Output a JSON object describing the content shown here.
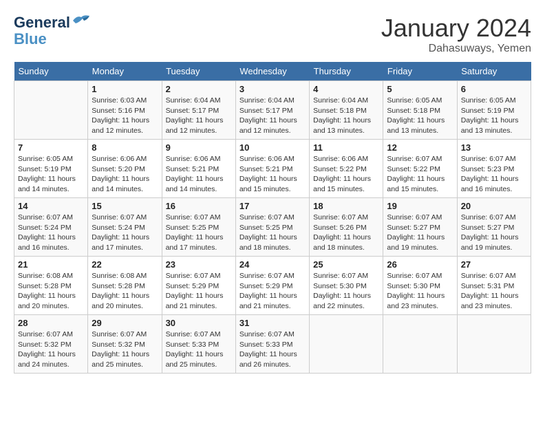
{
  "header": {
    "logo_line1": "General",
    "logo_line2": "Blue",
    "month_title": "January 2024",
    "location": "Dahasuways, Yemen"
  },
  "weekdays": [
    "Sunday",
    "Monday",
    "Tuesday",
    "Wednesday",
    "Thursday",
    "Friday",
    "Saturday"
  ],
  "weeks": [
    [
      {
        "day": "",
        "sunrise": "",
        "sunset": "",
        "daylight": ""
      },
      {
        "day": "1",
        "sunrise": "Sunrise: 6:03 AM",
        "sunset": "Sunset: 5:16 PM",
        "daylight": "Daylight: 11 hours and 12 minutes."
      },
      {
        "day": "2",
        "sunrise": "Sunrise: 6:04 AM",
        "sunset": "Sunset: 5:17 PM",
        "daylight": "Daylight: 11 hours and 12 minutes."
      },
      {
        "day": "3",
        "sunrise": "Sunrise: 6:04 AM",
        "sunset": "Sunset: 5:17 PM",
        "daylight": "Daylight: 11 hours and 12 minutes."
      },
      {
        "day": "4",
        "sunrise": "Sunrise: 6:04 AM",
        "sunset": "Sunset: 5:18 PM",
        "daylight": "Daylight: 11 hours and 13 minutes."
      },
      {
        "day": "5",
        "sunrise": "Sunrise: 6:05 AM",
        "sunset": "Sunset: 5:18 PM",
        "daylight": "Daylight: 11 hours and 13 minutes."
      },
      {
        "day": "6",
        "sunrise": "Sunrise: 6:05 AM",
        "sunset": "Sunset: 5:19 PM",
        "daylight": "Daylight: 11 hours and 13 minutes."
      }
    ],
    [
      {
        "day": "7",
        "sunrise": "Sunrise: 6:05 AM",
        "sunset": "Sunset: 5:19 PM",
        "daylight": "Daylight: 11 hours and 14 minutes."
      },
      {
        "day": "8",
        "sunrise": "Sunrise: 6:06 AM",
        "sunset": "Sunset: 5:20 PM",
        "daylight": "Daylight: 11 hours and 14 minutes."
      },
      {
        "day": "9",
        "sunrise": "Sunrise: 6:06 AM",
        "sunset": "Sunset: 5:21 PM",
        "daylight": "Daylight: 11 hours and 14 minutes."
      },
      {
        "day": "10",
        "sunrise": "Sunrise: 6:06 AM",
        "sunset": "Sunset: 5:21 PM",
        "daylight": "Daylight: 11 hours and 15 minutes."
      },
      {
        "day": "11",
        "sunrise": "Sunrise: 6:06 AM",
        "sunset": "Sunset: 5:22 PM",
        "daylight": "Daylight: 11 hours and 15 minutes."
      },
      {
        "day": "12",
        "sunrise": "Sunrise: 6:07 AM",
        "sunset": "Sunset: 5:22 PM",
        "daylight": "Daylight: 11 hours and 15 minutes."
      },
      {
        "day": "13",
        "sunrise": "Sunrise: 6:07 AM",
        "sunset": "Sunset: 5:23 PM",
        "daylight": "Daylight: 11 hours and 16 minutes."
      }
    ],
    [
      {
        "day": "14",
        "sunrise": "Sunrise: 6:07 AM",
        "sunset": "Sunset: 5:24 PM",
        "daylight": "Daylight: 11 hours and 16 minutes."
      },
      {
        "day": "15",
        "sunrise": "Sunrise: 6:07 AM",
        "sunset": "Sunset: 5:24 PM",
        "daylight": "Daylight: 11 hours and 17 minutes."
      },
      {
        "day": "16",
        "sunrise": "Sunrise: 6:07 AM",
        "sunset": "Sunset: 5:25 PM",
        "daylight": "Daylight: 11 hours and 17 minutes."
      },
      {
        "day": "17",
        "sunrise": "Sunrise: 6:07 AM",
        "sunset": "Sunset: 5:25 PM",
        "daylight": "Daylight: 11 hours and 18 minutes."
      },
      {
        "day": "18",
        "sunrise": "Sunrise: 6:07 AM",
        "sunset": "Sunset: 5:26 PM",
        "daylight": "Daylight: 11 hours and 18 minutes."
      },
      {
        "day": "19",
        "sunrise": "Sunrise: 6:07 AM",
        "sunset": "Sunset: 5:27 PM",
        "daylight": "Daylight: 11 hours and 19 minutes."
      },
      {
        "day": "20",
        "sunrise": "Sunrise: 6:07 AM",
        "sunset": "Sunset: 5:27 PM",
        "daylight": "Daylight: 11 hours and 19 minutes."
      }
    ],
    [
      {
        "day": "21",
        "sunrise": "Sunrise: 6:08 AM",
        "sunset": "Sunset: 5:28 PM",
        "daylight": "Daylight: 11 hours and 20 minutes."
      },
      {
        "day": "22",
        "sunrise": "Sunrise: 6:08 AM",
        "sunset": "Sunset: 5:28 PM",
        "daylight": "Daylight: 11 hours and 20 minutes."
      },
      {
        "day": "23",
        "sunrise": "Sunrise: 6:07 AM",
        "sunset": "Sunset: 5:29 PM",
        "daylight": "Daylight: 11 hours and 21 minutes."
      },
      {
        "day": "24",
        "sunrise": "Sunrise: 6:07 AM",
        "sunset": "Sunset: 5:29 PM",
        "daylight": "Daylight: 11 hours and 21 minutes."
      },
      {
        "day": "25",
        "sunrise": "Sunrise: 6:07 AM",
        "sunset": "Sunset: 5:30 PM",
        "daylight": "Daylight: 11 hours and 22 minutes."
      },
      {
        "day": "26",
        "sunrise": "Sunrise: 6:07 AM",
        "sunset": "Sunset: 5:30 PM",
        "daylight": "Daylight: 11 hours and 23 minutes."
      },
      {
        "day": "27",
        "sunrise": "Sunrise: 6:07 AM",
        "sunset": "Sunset: 5:31 PM",
        "daylight": "Daylight: 11 hours and 23 minutes."
      }
    ],
    [
      {
        "day": "28",
        "sunrise": "Sunrise: 6:07 AM",
        "sunset": "Sunset: 5:32 PM",
        "daylight": "Daylight: 11 hours and 24 minutes."
      },
      {
        "day": "29",
        "sunrise": "Sunrise: 6:07 AM",
        "sunset": "Sunset: 5:32 PM",
        "daylight": "Daylight: 11 hours and 25 minutes."
      },
      {
        "day": "30",
        "sunrise": "Sunrise: 6:07 AM",
        "sunset": "Sunset: 5:33 PM",
        "daylight": "Daylight: 11 hours and 25 minutes."
      },
      {
        "day": "31",
        "sunrise": "Sunrise: 6:07 AM",
        "sunset": "Sunset: 5:33 PM",
        "daylight": "Daylight: 11 hours and 26 minutes."
      },
      {
        "day": "",
        "sunrise": "",
        "sunset": "",
        "daylight": ""
      },
      {
        "day": "",
        "sunrise": "",
        "sunset": "",
        "daylight": ""
      },
      {
        "day": "",
        "sunrise": "",
        "sunset": "",
        "daylight": ""
      }
    ]
  ]
}
